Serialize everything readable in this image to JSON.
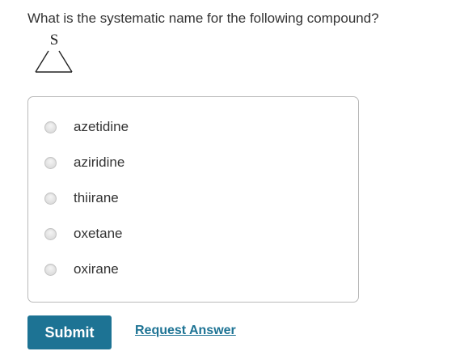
{
  "question": {
    "text": "What is the systematic name for the following compound?"
  },
  "molecule": {
    "atom_label": "S"
  },
  "choices": [
    {
      "label": "azetidine"
    },
    {
      "label": "aziridine"
    },
    {
      "label": "thiirane"
    },
    {
      "label": "oxetane"
    },
    {
      "label": "oxirane"
    }
  ],
  "actions": {
    "submit_label": "Submit",
    "request_answer_label": "Request Answer"
  },
  "colors": {
    "primary": "#1d7394",
    "text": "#333333",
    "border": "#b9b9b9"
  }
}
